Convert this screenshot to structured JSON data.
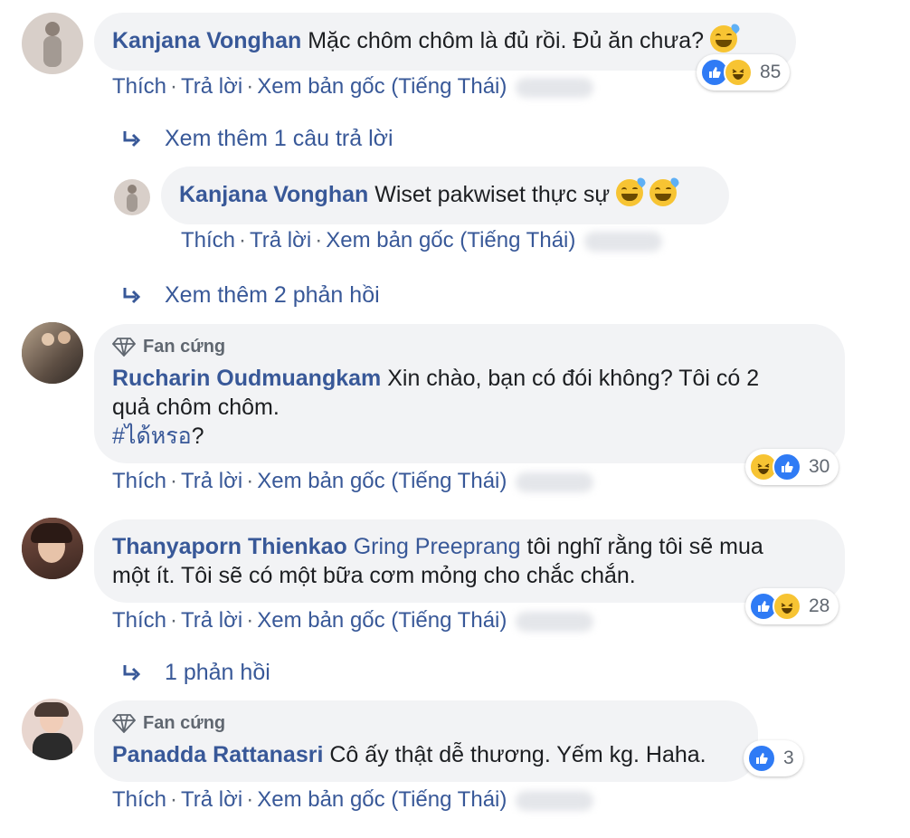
{
  "comments": [
    {
      "author": "Kanjana Vonghan",
      "text": "Mặc chôm chôm là đủ rồi. Đủ ăn chưa?",
      "reaction_count": "85",
      "actions": {
        "like": "Thích",
        "reply": "Trả lời",
        "see_original": "Xem bản gốc (Tiếng Thái)"
      }
    },
    {
      "more_label": "Xem thêm 1 câu trả lời"
    },
    {
      "author": "Kanjana Vonghan",
      "text": "Wiset pakwiset thực sự",
      "actions": {
        "like": "Thích",
        "reply": "Trả lời",
        "see_original": "Xem bản gốc (Tiếng Thái)"
      }
    },
    {
      "more_label": "Xem thêm 2 phản hồi"
    },
    {
      "badge": "Fan cứng",
      "author": "Rucharin Oudmuangkam",
      "text_line1": "Xin chào, bạn có đói không? Tôi có 2",
      "text_line2": "quả chôm chôm.",
      "hashtag": "#ได้หรอ",
      "hashtag_suffix": "?",
      "reaction_count": "30",
      "actions": {
        "like": "Thích",
        "reply": "Trả lời",
        "see_original": "Xem bản gốc (Tiếng Thái)"
      }
    },
    {
      "author": "Thanyaporn Thienkao",
      "mention": "Gring Preeprang",
      "text_line1": "tôi nghĩ rằng tôi sẽ mua",
      "text_line2": "một ít. Tôi sẽ có một bữa cơm mỏng cho chắc chắn.",
      "reaction_count": "28",
      "actions": {
        "like": "Thích",
        "reply": "Trả lời",
        "see_original": "Xem bản gốc (Tiếng Thái)"
      }
    },
    {
      "more_label": "1 phản hồi"
    },
    {
      "badge": "Fan cứng",
      "author": "Panadda Rattanasri",
      "text": "Cô ấy thật dễ thương. Yếm kg. Haha.",
      "reaction_count": "3",
      "actions": {
        "like": "Thích",
        "reply": "Trả lời",
        "see_original": "Xem bản gốc (Tiếng Thái)"
      }
    }
  ],
  "separator": "·",
  "colors": {
    "link": "#385898",
    "bubble": "#f2f3f5",
    "like": "#2f7bf5",
    "haha": "#f7c433"
  }
}
